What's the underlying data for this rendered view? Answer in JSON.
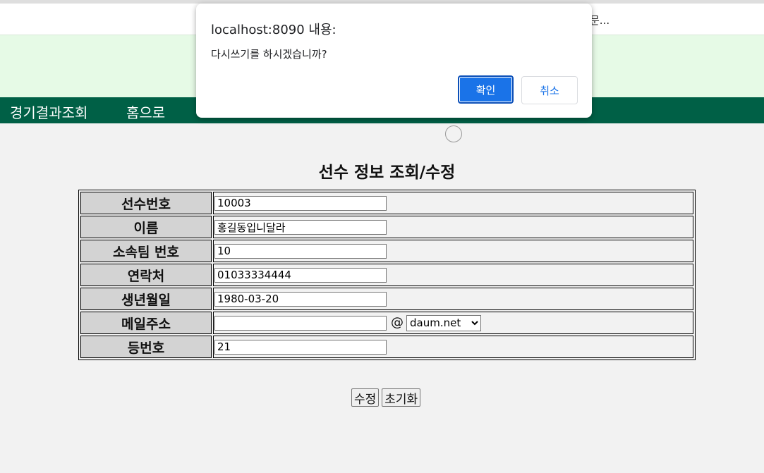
{
  "header": {
    "left_fragment": "",
    "right_fragment": "문..."
  },
  "nav": {
    "items": [
      {
        "label": "경기결과조회"
      },
      {
        "label": "홈으로"
      }
    ]
  },
  "page": {
    "title": "선수 정보 조회/수정"
  },
  "form": {
    "rows": [
      {
        "label": "선수번호",
        "value": "10003"
      },
      {
        "label": "이름",
        "value": "홍길동입니달라"
      },
      {
        "label": "소속팀 번호",
        "value": "10"
      },
      {
        "label": "연락처",
        "value": "01033334444"
      },
      {
        "label": "생년월일",
        "value": "1980-03-20"
      },
      {
        "label": "메일주소",
        "value": "",
        "at": "@",
        "domain_selected": "daum.net"
      },
      {
        "label": "등번호",
        "value": "21"
      }
    ]
  },
  "buttons": {
    "submit": "수정",
    "reset": "초기화"
  },
  "dialog": {
    "title": "localhost:8090 내용:",
    "message": "다시쓰기를 하시겠습니까?",
    "ok": "확인",
    "cancel": "취소"
  },
  "colors": {
    "nav_bg": "#006046",
    "header_bg": "#e6fae6",
    "label_bg": "#d3d3d3",
    "ok_button": "#1a73e8"
  }
}
